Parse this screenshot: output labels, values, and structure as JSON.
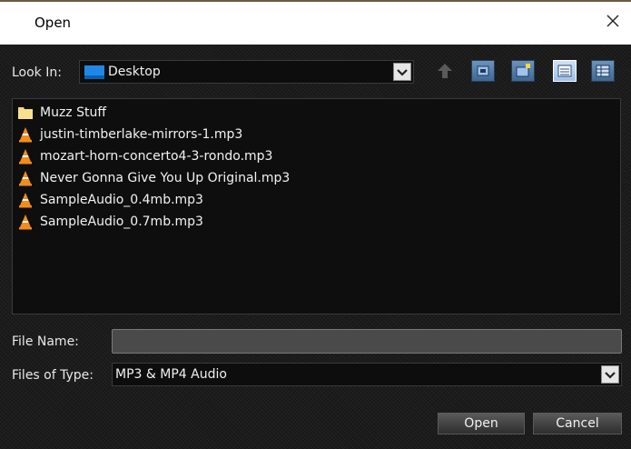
{
  "window": {
    "title": "Open"
  },
  "look_in": {
    "label": "Look In:",
    "value": "Desktop"
  },
  "toolbar": {
    "buttons": [
      "up-one-level-icon",
      "desktop-icon",
      "new-folder-icon",
      "list-view-icon",
      "details-view-icon"
    ]
  },
  "files": [
    {
      "name": "Muzz Stuff",
      "icon": "folder-icon"
    },
    {
      "name": "justin-timberlake-mirrors-1.mp3",
      "icon": "vlc-icon"
    },
    {
      "name": "mozart-horn-concerto4-3-rondo.mp3",
      "icon": "vlc-icon"
    },
    {
      "name": "Never Gonna Give You Up Original.mp3",
      "icon": "vlc-icon"
    },
    {
      "name": "SampleAudio_0.4mb.mp3",
      "icon": "vlc-icon"
    },
    {
      "name": "SampleAudio_0.7mb.mp3",
      "icon": "vlc-icon"
    }
  ],
  "file_name": {
    "label": "File Name:",
    "value": ""
  },
  "file_type": {
    "label": "Files of Type:",
    "value": "MP3 & MP4 Audio"
  },
  "buttons": {
    "open": "Open",
    "cancel": "Cancel"
  }
}
